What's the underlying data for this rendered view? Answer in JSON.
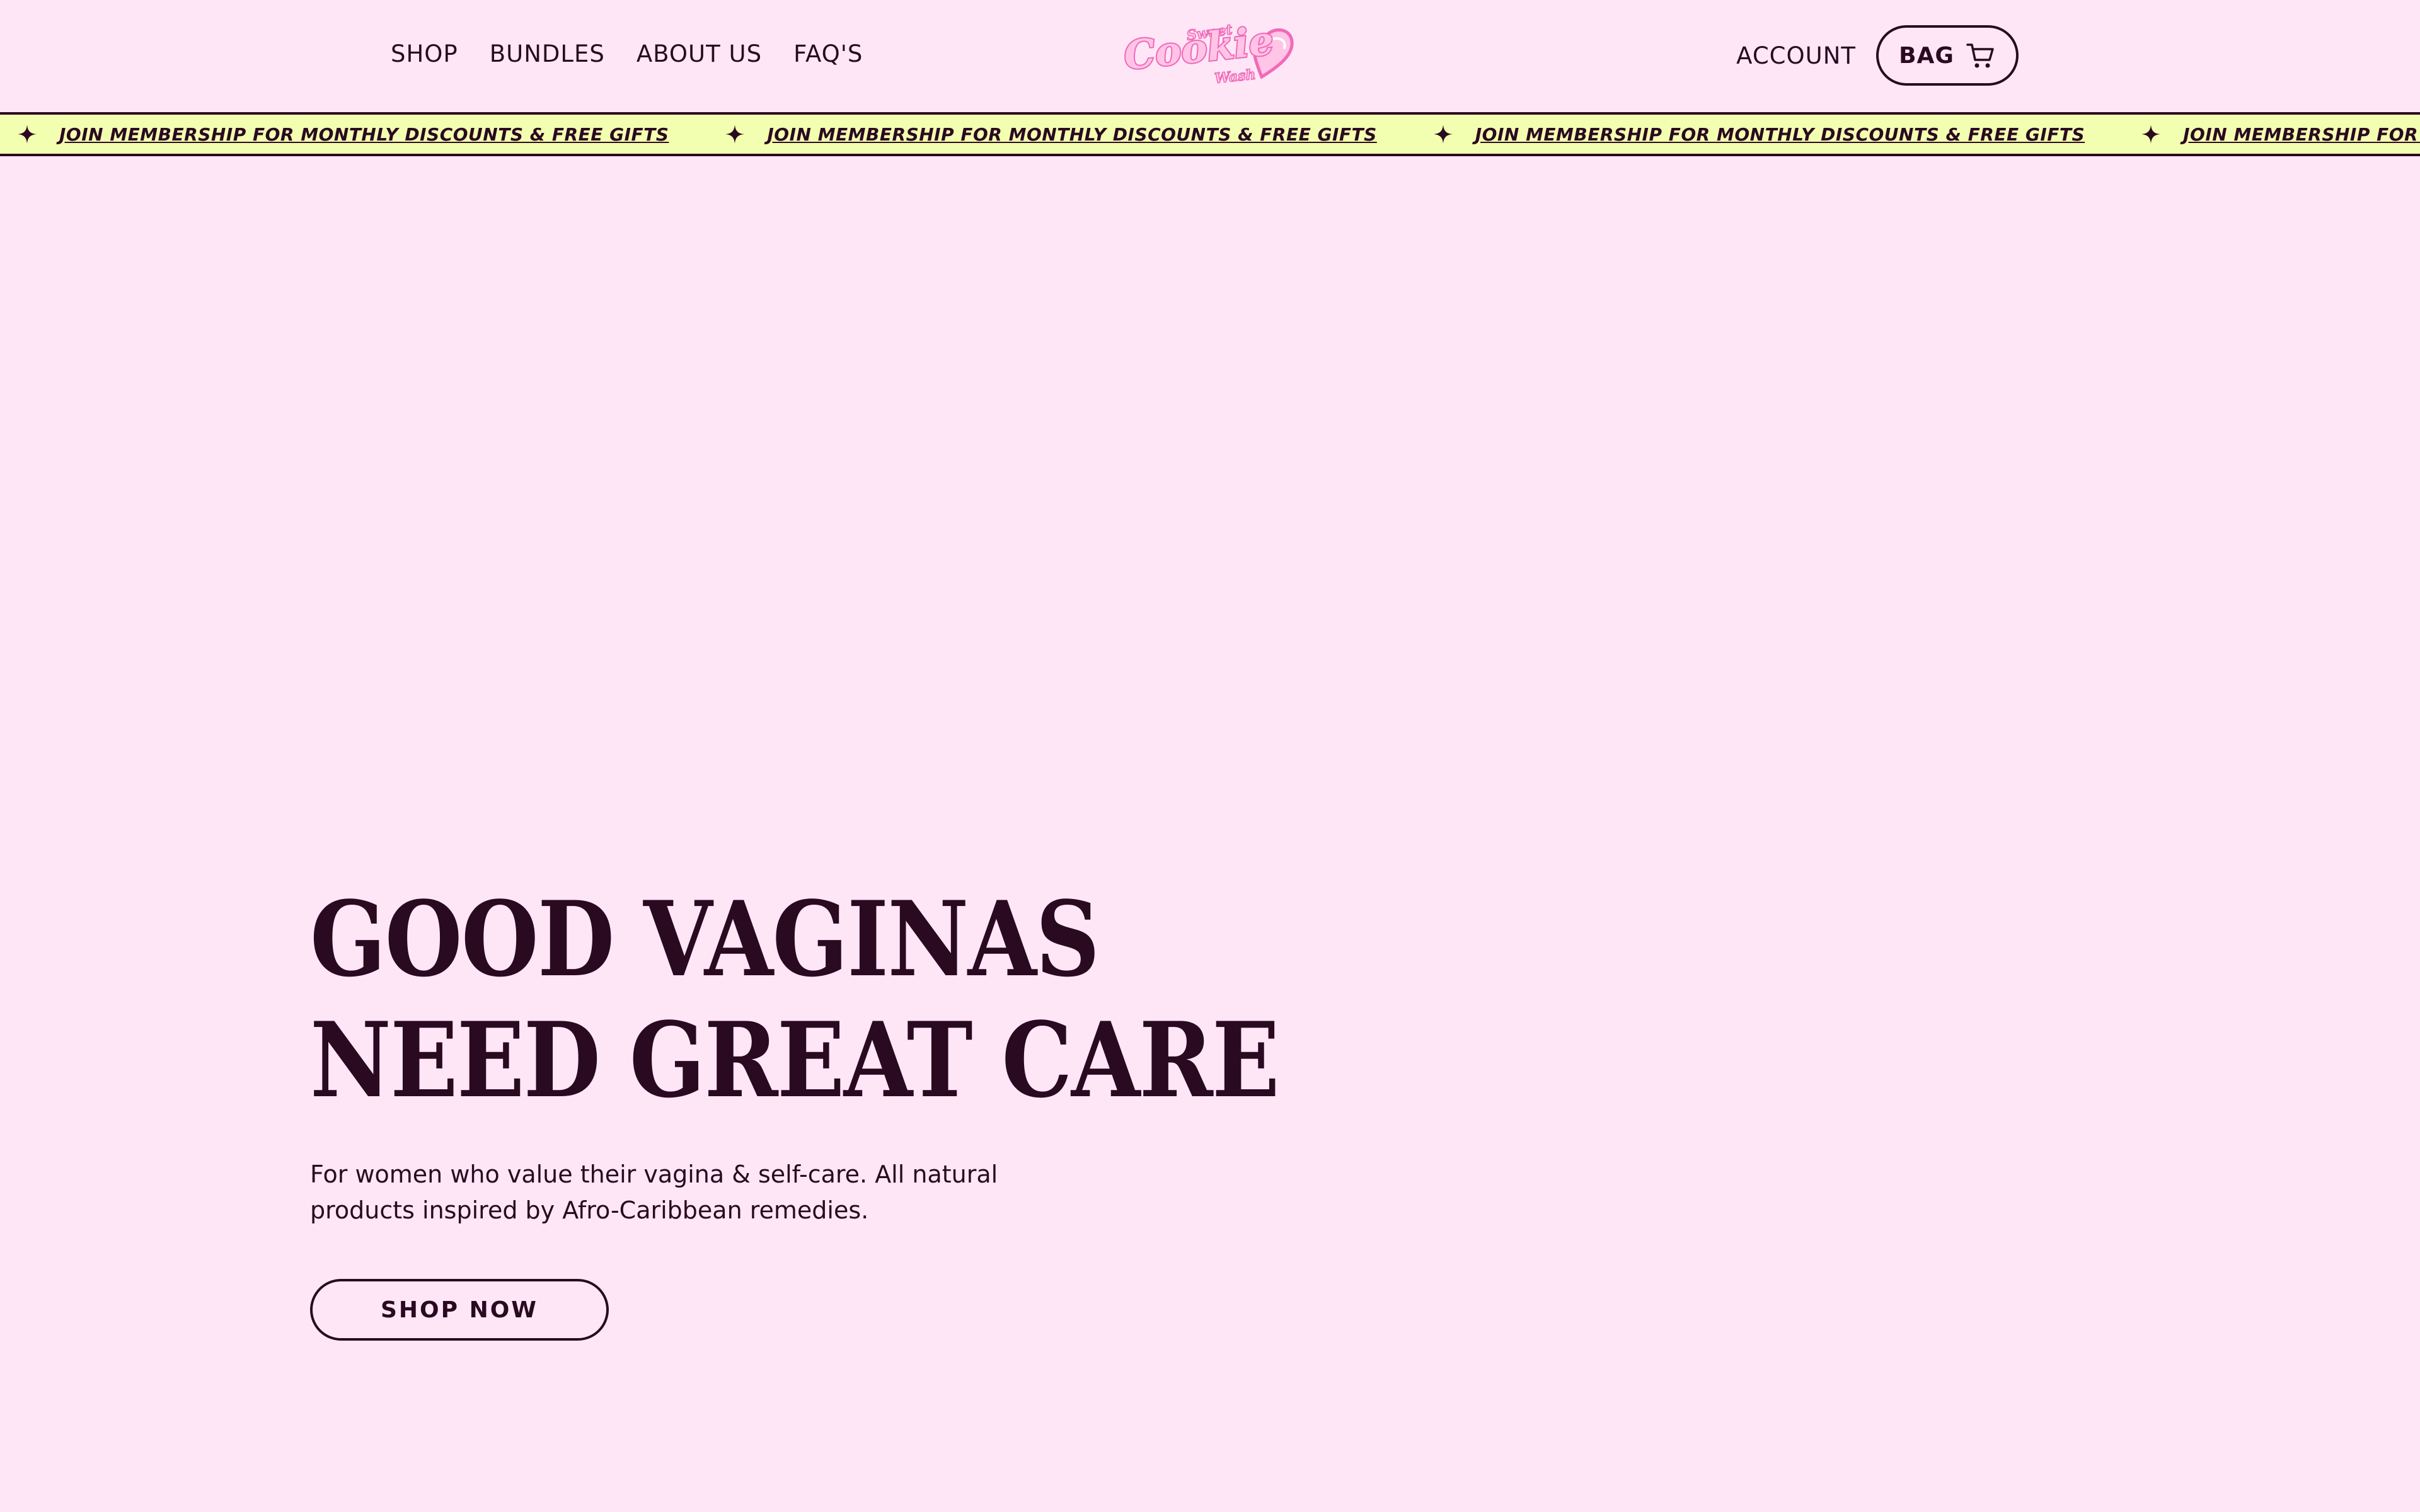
{
  "header": {
    "nav": [
      {
        "label": "SHOP"
      },
      {
        "label": "BUNDLES"
      },
      {
        "label": "ABOUT US"
      },
      {
        "label": "FAQ'S"
      }
    ],
    "logo": {
      "top_word": "Sweet",
      "main_word": "Cookie",
      "bottom_word": "Wash",
      "icon": "heart-icon"
    },
    "account_label": "ACCOUNT",
    "bag_label": "BAG",
    "bag_icon": "cart-icon"
  },
  "announcement": {
    "text": "JOIN MEMBERSHIP FOR MONTHLY DISCOUNTS & FREE GIFTS",
    "icon": "star-icon",
    "background": "#f3ffb0"
  },
  "hero": {
    "title_line_1": "GOOD VAGINAS",
    "title_line_2": "NEED GREAT CARE",
    "subtitle_line_1": "For women who value their vagina & self-care. All natural",
    "subtitle_line_2": "products inspired by Afro-Caribbean remedies.",
    "cta_label": "SHOP NOW"
  },
  "colors": {
    "background": "#ffe6f7",
    "text": "#2a0a20",
    "brand_pink": "#f06ab8",
    "brand_pink_light": "#ffc4e6"
  }
}
